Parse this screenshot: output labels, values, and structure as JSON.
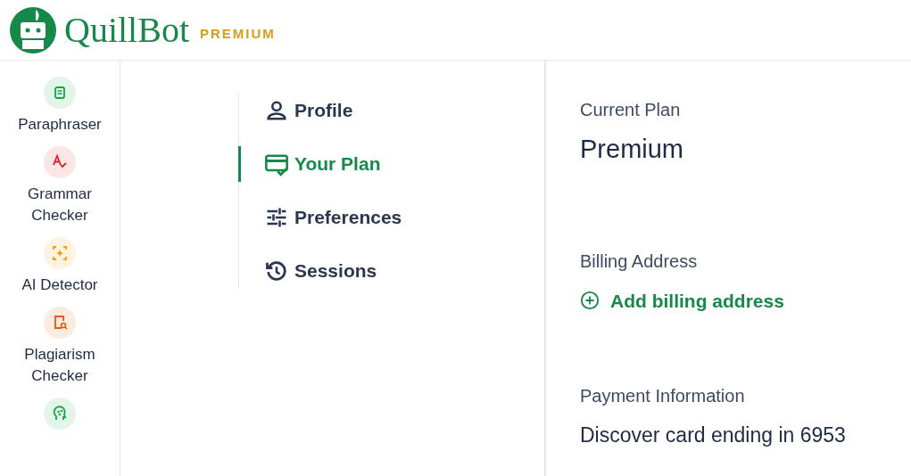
{
  "header": {
    "brand": "QuillBot",
    "tier": "PREMIUM"
  },
  "sidebar": {
    "items": [
      {
        "label": "Paraphraser",
        "color": "#16a34a"
      },
      {
        "label": "Grammar Checker",
        "color": "#dc2626"
      },
      {
        "label": "AI Detector",
        "color": "#f59e0b"
      },
      {
        "label": "Plagiarism Checker",
        "color": "#ea580c"
      },
      {
        "color": "#16a34a"
      }
    ]
  },
  "settings_nav": {
    "items": [
      {
        "label": "Profile",
        "selected": false
      },
      {
        "label": "Your Plan",
        "selected": true
      },
      {
        "label": "Preferences",
        "selected": false
      },
      {
        "label": "Sessions",
        "selected": false
      }
    ]
  },
  "plan": {
    "current_plan_label": "Current Plan",
    "current_plan": "Premium",
    "billing_label": "Billing Address",
    "add_billing": "Add billing address",
    "payment_label": "Payment Information",
    "payment": "Discover card ending in 6953"
  }
}
